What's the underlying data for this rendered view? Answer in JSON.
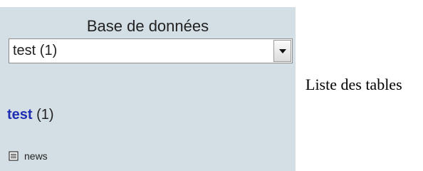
{
  "sidebar": {
    "db_label": "Base de données",
    "db_select": {
      "selected": "test (1)"
    },
    "db_link": {
      "name": "test",
      "count": "(1)"
    },
    "tables": [
      {
        "name": "news",
        "icon": "table-icon"
      }
    ]
  },
  "main": {
    "text": "Liste des tables"
  },
  "colors": {
    "sidebar_bg": "#d4dee5",
    "link": "#1f2fb4"
  }
}
